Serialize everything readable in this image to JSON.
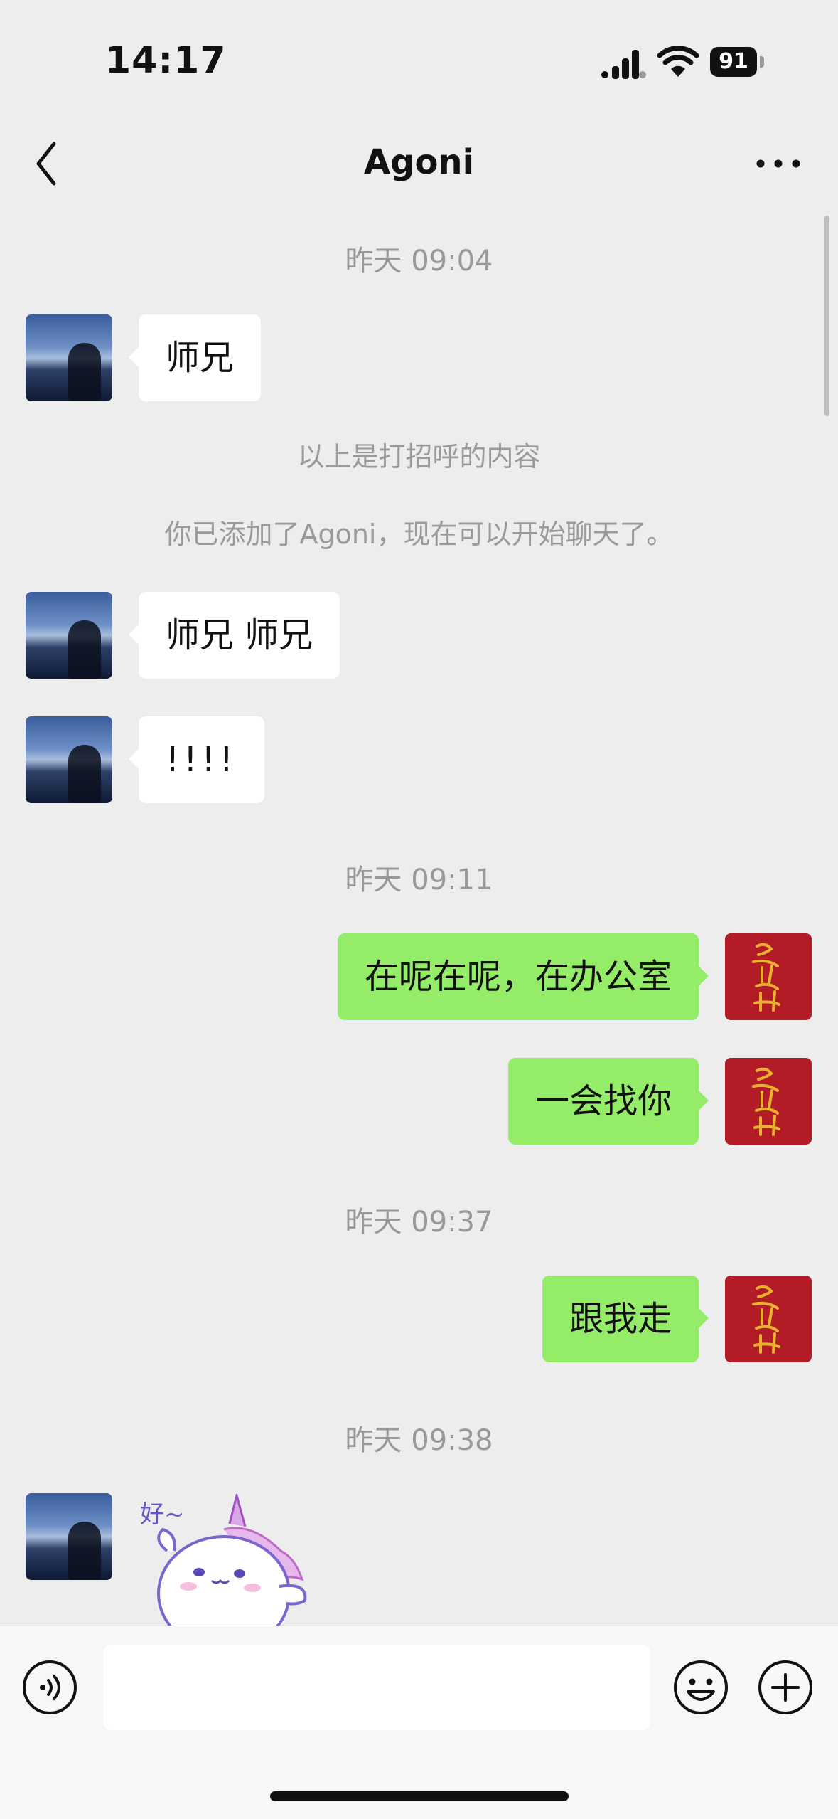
{
  "status_bar": {
    "time": "14:17",
    "battery": "91"
  },
  "header": {
    "title": "Agoni"
  },
  "messages": [
    {
      "kind": "timestamp",
      "text": "昨天 09:04"
    },
    {
      "kind": "incoming",
      "text": "师兄"
    },
    {
      "kind": "system",
      "text": "以上是打招呼的内容"
    },
    {
      "kind": "system",
      "text": "你已添加了Agoni，现在可以开始聊天了。"
    },
    {
      "kind": "incoming",
      "text": "师兄 师兄"
    },
    {
      "kind": "incoming",
      "text": "!!!!"
    },
    {
      "kind": "timestamp",
      "text": "昨天 09:11"
    },
    {
      "kind": "outgoing",
      "text": "在呢在呢，在办公室"
    },
    {
      "kind": "outgoing",
      "text": "一会找你"
    },
    {
      "kind": "timestamp",
      "text": "昨天 09:37"
    },
    {
      "kind": "outgoing",
      "text": "跟我走"
    },
    {
      "kind": "timestamp",
      "text": "昨天 09:38"
    },
    {
      "kind": "incoming-sticker",
      "text": "好~"
    }
  ],
  "input": {
    "value": ""
  },
  "icons": {
    "back": "chevron-left-icon",
    "more": "more-dots-icon",
    "voice": "voice-icon",
    "emoji": "emoji-icon",
    "plus": "plus-icon"
  },
  "colors": {
    "outgoing_bubble": "#95ec69",
    "incoming_bubble": "#ffffff",
    "background": "#ededed"
  }
}
